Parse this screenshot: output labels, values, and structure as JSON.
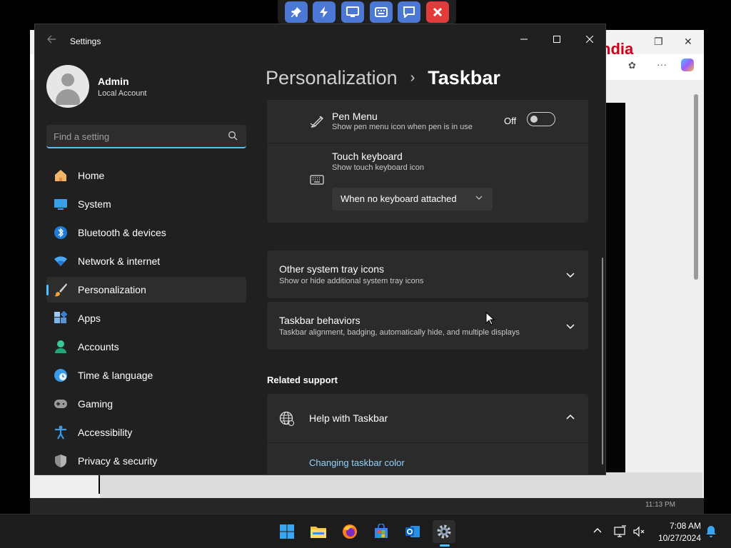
{
  "remote_toolbar": {
    "icons": [
      "pin-icon",
      "lightning-icon",
      "monitor-icon",
      "keyboard-icon",
      "chat-icon",
      "close-icon"
    ]
  },
  "background_window": {
    "brand_text": "ndia",
    "taskbar_time": "11:13 PM"
  },
  "window": {
    "title": "Settings",
    "minimize_glyph": "—",
    "maximize_glyph": "☐",
    "close_glyph": "✕"
  },
  "user": {
    "name": "Admin",
    "account_type": "Local Account"
  },
  "search": {
    "placeholder": "Find a setting"
  },
  "nav": {
    "items": [
      {
        "label": "Home",
        "icon": "home-icon"
      },
      {
        "label": "System",
        "icon": "system-icon"
      },
      {
        "label": "Bluetooth & devices",
        "icon": "bluetooth-icon"
      },
      {
        "label": "Network & internet",
        "icon": "network-icon"
      },
      {
        "label": "Personalization",
        "icon": "brush-icon",
        "active": true
      },
      {
        "label": "Apps",
        "icon": "apps-icon"
      },
      {
        "label": "Accounts",
        "icon": "accounts-icon"
      },
      {
        "label": "Time & language",
        "icon": "globe-clock-icon"
      },
      {
        "label": "Gaming",
        "icon": "gamepad-icon"
      },
      {
        "label": "Accessibility",
        "icon": "accessibility-icon"
      },
      {
        "label": "Privacy & security",
        "icon": "shield-icon"
      }
    ]
  },
  "header": {
    "parent": "Personalization",
    "separator": "›",
    "current": "Taskbar"
  },
  "pen_menu": {
    "title": "Pen Menu",
    "description": "Show pen menu icon when pen is in use",
    "toggle_label": "Off",
    "enabled": false
  },
  "touch_keyboard": {
    "title": "Touch keyboard",
    "description": "Show touch keyboard icon",
    "selected": "When no keyboard attached"
  },
  "other_tray_icons": {
    "title": "Other system tray icons",
    "description": "Show or hide additional system tray icons"
  },
  "taskbar_behaviors": {
    "title": "Taskbar behaviors",
    "description": "Taskbar alignment, badging, automatically hide, and multiple displays"
  },
  "related_support": {
    "heading": "Related support",
    "help_title": "Help with Taskbar",
    "link": "Changing taskbar color"
  },
  "taskbar": {
    "apps": [
      "windows-start-icon",
      "file-explorer-icon",
      "firefox-icon",
      "store-icon",
      "outlook-icon",
      "settings-icon"
    ],
    "clock_time": "7:08 AM",
    "clock_date": "10/27/2024"
  }
}
